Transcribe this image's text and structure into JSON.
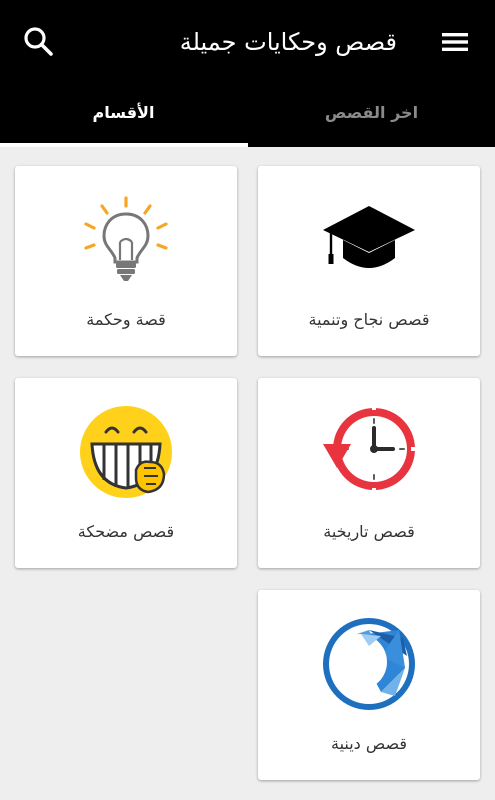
{
  "app": {
    "title": "قصص وحكايات جميلة"
  },
  "icons": {
    "search": "search-icon",
    "menu": "hamburger-menu-icon"
  },
  "tabs": [
    {
      "label": "الأقسام",
      "selected": true
    },
    {
      "label": "اخر القصص",
      "selected": false
    }
  ],
  "categories": [
    {
      "label": "قصص نجاح وتنمية",
      "icon": "graduation-cap-icon"
    },
    {
      "label": "قصة وحكمة",
      "icon": "lightbulb-icon"
    },
    {
      "label": "قصص تاريخية",
      "icon": "history-clock-icon"
    },
    {
      "label": "قصص مضحكة",
      "icon": "laughing-emoji-icon"
    },
    {
      "label": "قصص دينية",
      "icon": "crescent-moon-icon"
    }
  ],
  "colors": {
    "appbar": "#000000",
    "background": "#eeeeee",
    "tab_active": "#ffffff",
    "tab_inactive": "#8a8a8a"
  }
}
